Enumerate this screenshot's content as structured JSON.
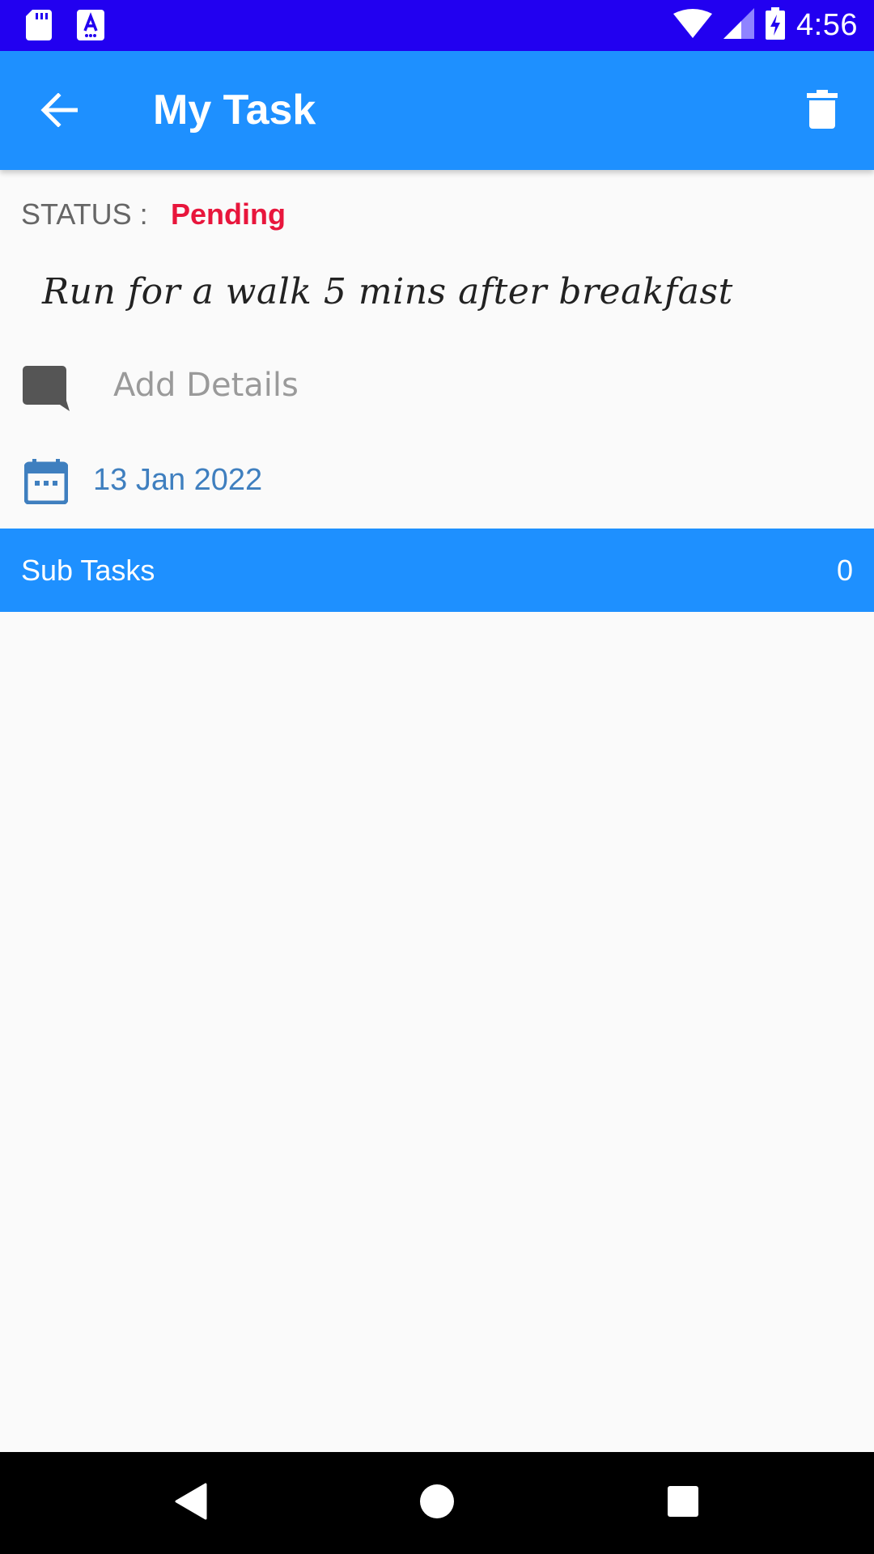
{
  "status_bar": {
    "time": "4:56",
    "icons": [
      "sd-card-icon",
      "accessibility-a-icon",
      "wifi-icon",
      "cell-signal-icon",
      "battery-charging-icon"
    ]
  },
  "app_bar": {
    "title": "My Task",
    "back_icon": "arrow-back-icon",
    "delete_icon": "trash-icon",
    "color": "#1e90ff"
  },
  "task": {
    "status_label": "STATUS :",
    "status_value": "Pending",
    "status_color": "#e8163c",
    "title": "Run for a walk 5 mins after breakfast",
    "details_value": "",
    "details_placeholder": "Add Details",
    "date": "13 Jan 2022"
  },
  "subtasks": {
    "label": "Sub Tasks",
    "count": "0"
  },
  "nav_bar": {
    "buttons": [
      "back-triangle-icon",
      "home-circle-icon",
      "recents-square-icon"
    ]
  }
}
